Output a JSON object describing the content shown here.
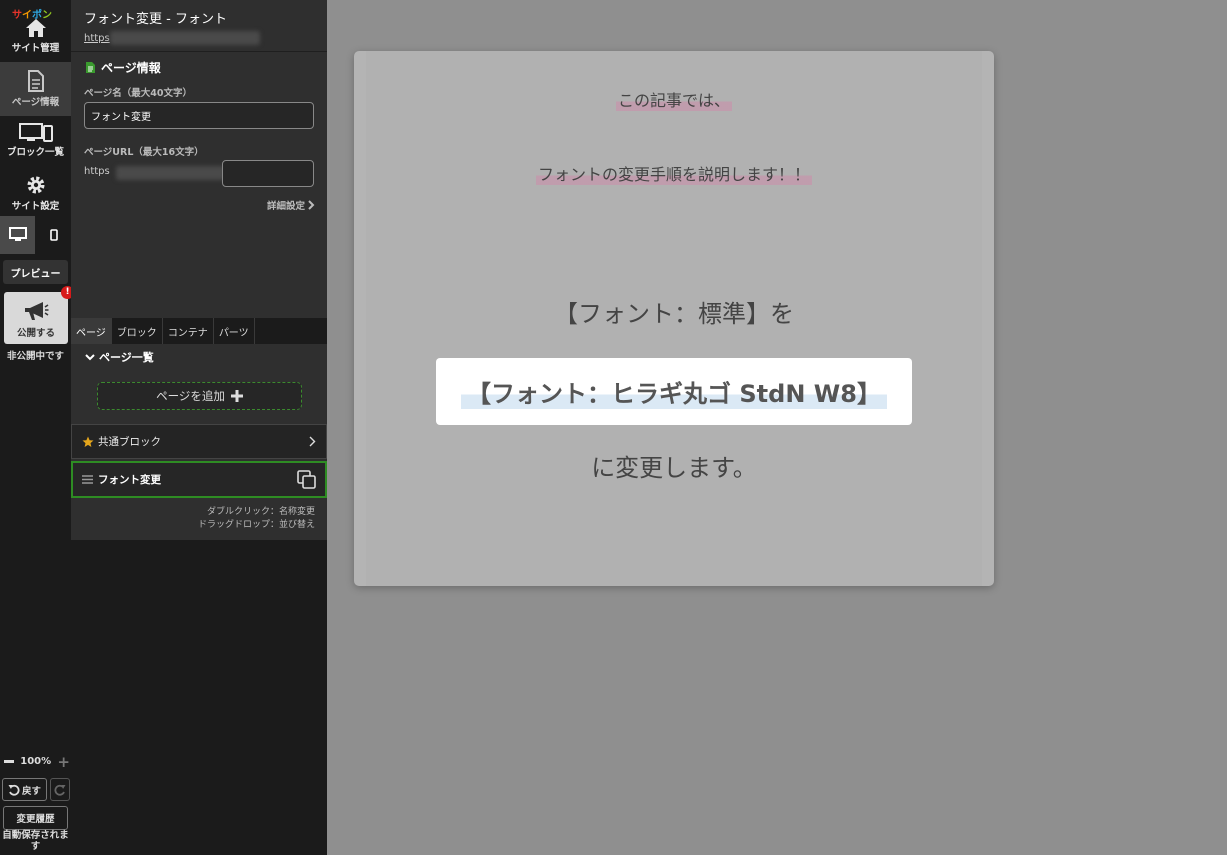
{
  "app": {
    "logo": [
      "サ",
      "イ",
      "ポ",
      "ン"
    ],
    "logo_colors": [
      "#e6332a",
      "#f39800",
      "#2ea7e0",
      "#8fc31f"
    ]
  },
  "rail": {
    "site_manage": "サイト管理",
    "page_info": "ページ情報",
    "block_list": "ブロック一覧",
    "site_settings": "サイト設定",
    "preview": "プレビュー",
    "publish": "公開する",
    "publish_badge": "!",
    "unpublished": "非公開中です",
    "zoom": "100%",
    "undo": "戻す",
    "history": "変更履歴",
    "autosave": "自動保存されます"
  },
  "panel": {
    "title": "フォント変更 - フォント",
    "url_prefix": "https",
    "section_title": "ページ情報",
    "page_name_label": "ページ名（最大40文字）",
    "page_name_value": "フォント変更",
    "page_url_label": "ページURL（最大16文字）",
    "page_url_prefix": "https",
    "advanced": "詳細設定",
    "tabs": [
      "ページ",
      "ブロック",
      "コンテナ",
      "パーツ"
    ],
    "list_title": "ページ一覧",
    "add_page": "ページを追加",
    "common_block": "共通ブロック",
    "current_page": "フォント変更",
    "hint_dblclick": "ダブルクリック：名称変更",
    "hint_drag": "ドラッグドロップ：並び替え"
  },
  "canvas": {
    "line1": "この記事では、",
    "line2": "フォントの変更手順を説明します！！",
    "line3": "【フォント：標準】を",
    "highlight": "【フォント：ヒラギ丸ゴ StdN W8】",
    "line4": "に変更します。"
  }
}
